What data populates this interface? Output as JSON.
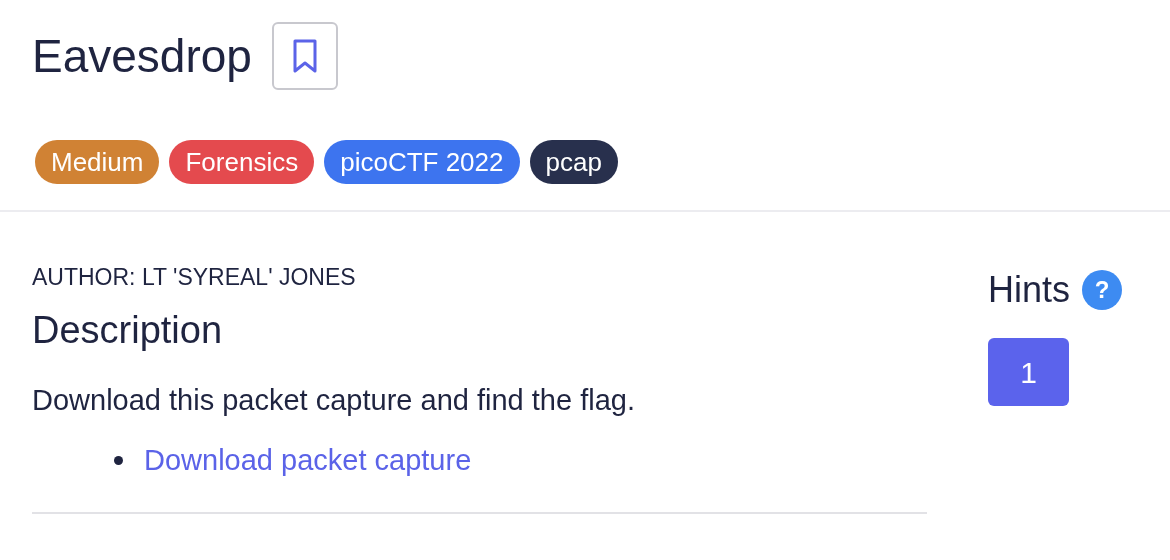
{
  "title": "Eavesdrop",
  "bookmark": {
    "selected": false
  },
  "tags": [
    {
      "label": "Medium",
      "color": "#d08234"
    },
    {
      "label": "Forensics",
      "color": "#e44a4e"
    },
    {
      "label": "picoCTF 2022",
      "color": "#3d74ef"
    },
    {
      "label": "pcap",
      "color": "#28304d"
    }
  ],
  "author": "AUTHOR: LT 'SYREAL' JONES",
  "description": {
    "heading": "Description",
    "text": "Download this packet capture and find the flag.",
    "links": [
      "Download packet capture"
    ]
  },
  "hints": {
    "heading": "Hints",
    "help_icon": "?",
    "buttons": [
      "1"
    ]
  }
}
